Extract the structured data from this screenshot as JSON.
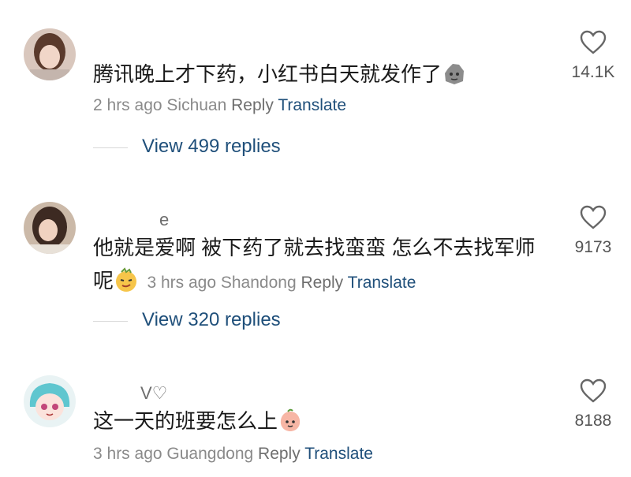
{
  "comments": [
    {
      "username": "",
      "text": "腾讯晚上才下药，小红书白天就发作了",
      "time": "2 hrs ago",
      "location": "Sichuan",
      "reply_label": "Reply",
      "translate_label": "Translate",
      "likes": "14.1K",
      "view_replies": "View 499 replies",
      "emoji": "stone-face-emoji"
    },
    {
      "username": "e",
      "text_line1": "他就是爱啊 被下药了就去找蛮蛮 怎么不去找军师",
      "text_line2": "呢",
      "time": "3 hrs ago",
      "location": "Shandong",
      "reply_label": "Reply",
      "translate_label": "Translate",
      "likes": "9173",
      "view_replies": "View 320 replies",
      "emoji": "smirk-orange-emoji"
    },
    {
      "username": "V♡",
      "text": "这一天的班要怎么上",
      "time": "3 hrs ago",
      "location": "Guangdong",
      "reply_label": "Reply",
      "translate_label": "Translate",
      "likes": "8188",
      "emoji": "peach-face-emoji"
    }
  ],
  "icons": {
    "like": "heart-outline-icon"
  },
  "colors": {
    "link": "#1f4f7a",
    "meta": "#8a8a8a",
    "text": "#1a1a1a"
  }
}
